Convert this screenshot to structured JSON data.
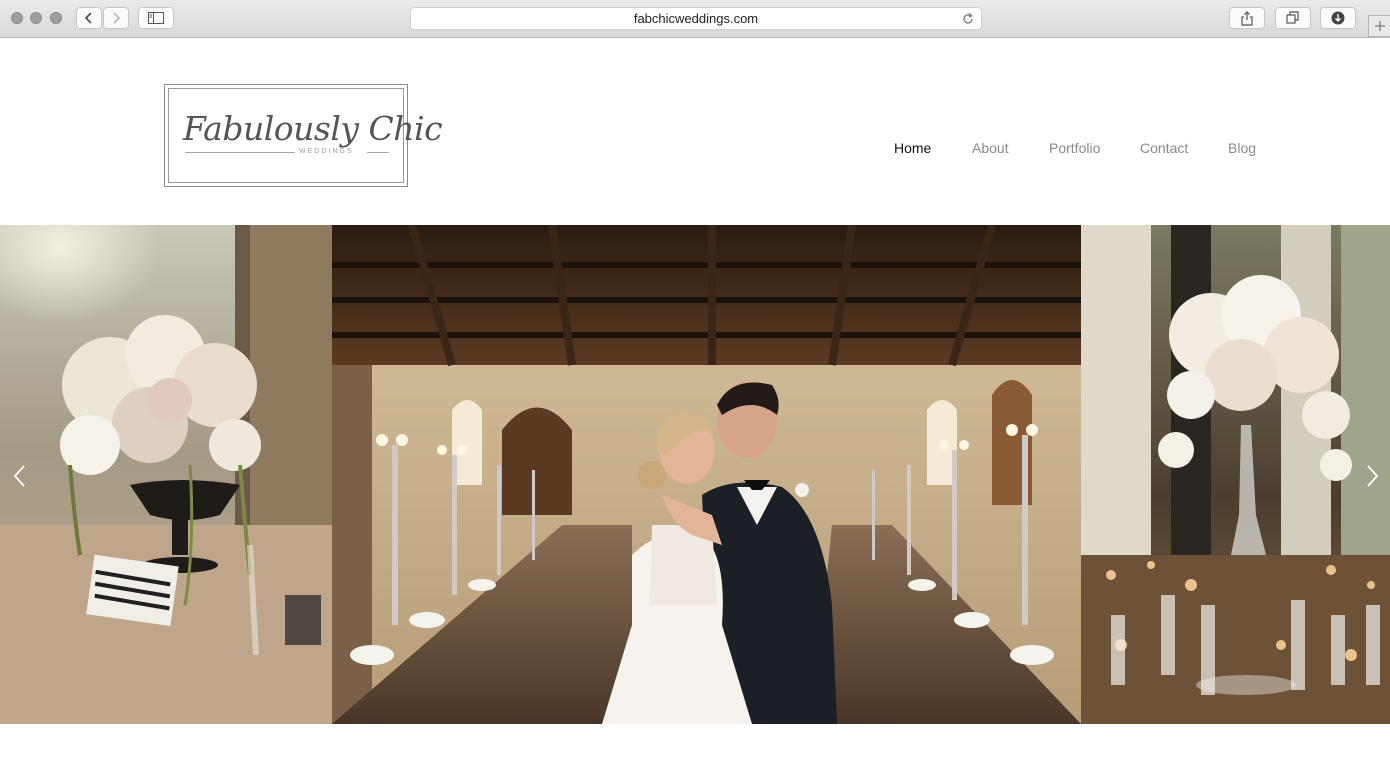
{
  "browser": {
    "url": "fabchicweddings.com",
    "icons": [
      "back-icon",
      "forward-icon",
      "sidebar-icon",
      "reload-icon",
      "share-icon",
      "tabs-icon",
      "downloads-icon",
      "new-tab-icon"
    ]
  },
  "site": {
    "logo": {
      "script": "Fabulously Chic",
      "subtitle": "WEDDINGS"
    },
    "nav": [
      {
        "label": "Home",
        "active": true
      },
      {
        "label": "About",
        "active": false
      },
      {
        "label": "Portfolio",
        "active": false
      },
      {
        "label": "Contact",
        "active": false
      },
      {
        "label": "Blog",
        "active": false
      }
    ]
  },
  "slider": {
    "slides": [
      "floral-centerpiece-photo",
      "couple-kiss-banquet-hall-photo",
      "orchid-centerpiece-photo"
    ],
    "prev_icon": "chevron-left-icon",
    "next_icon": "chevron-right-icon"
  },
  "colors": {
    "nav_active": "#111111",
    "nav_inactive": "#8a8a8a",
    "chrome_bg": "#dcdcdc"
  }
}
